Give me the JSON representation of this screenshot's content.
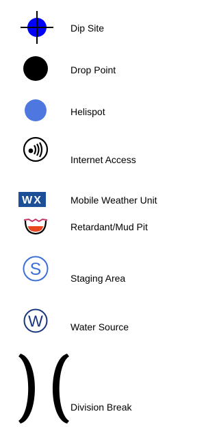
{
  "legend": {
    "items": [
      {
        "label": "Dip Site",
        "icon": "dip-site-icon"
      },
      {
        "label": "Drop Point",
        "icon": "drop-point-icon"
      },
      {
        "label": "Helispot",
        "icon": "helispot-icon"
      },
      {
        "label": "Internet Access",
        "icon": "internet-access-icon"
      },
      {
        "label": "Mobile Weather Unit",
        "icon": "mobile-weather-unit-icon",
        "icon_text": "WX"
      },
      {
        "label": "Retardant/Mud Pit",
        "icon": "retardant-mud-pit-icon"
      },
      {
        "label": "Staging Area",
        "icon": "staging-area-icon",
        "icon_text": "S"
      },
      {
        "label": "Water Source",
        "icon": "water-source-icon",
        "icon_text": "W"
      },
      {
        "label": "Division Break",
        "icon": "division-break-icon"
      }
    ]
  },
  "colors": {
    "blue": "#0000ff",
    "helispot_blue": "#4e78e0",
    "navy": "#1d4f99",
    "retardant_red": "#e8461e",
    "pit_outline": "#c83262",
    "ring_blue": "#3b6fd8",
    "water_navy": "#17337c",
    "black": "#000000"
  }
}
